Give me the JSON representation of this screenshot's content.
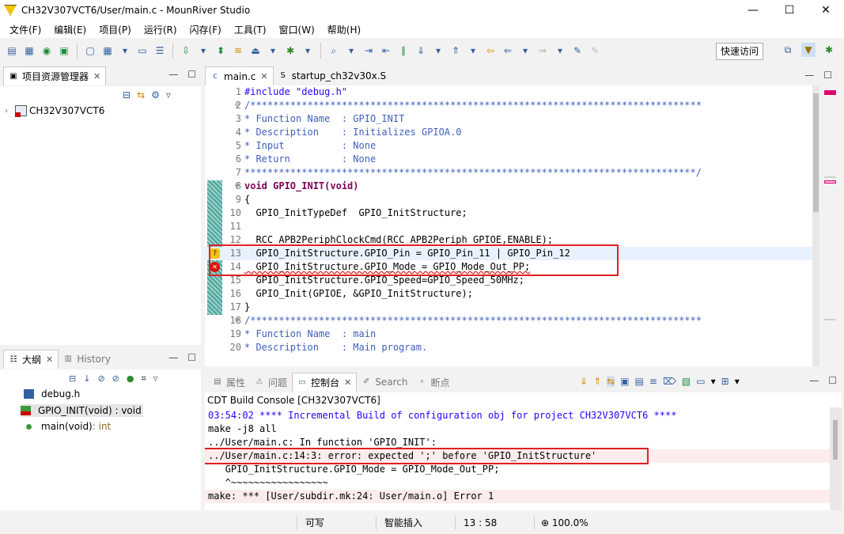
{
  "window": {
    "title": "CH32V307VCT6/User/main.c - MounRiver Studio",
    "minimize": "—",
    "maximize": "☐",
    "close": "✕"
  },
  "menu": [
    "文件(F)",
    "编辑(E)",
    "项目(P)",
    "运行(R)",
    "闪存(F)",
    "工具(T)",
    "窗口(W)",
    "帮助(H)"
  ],
  "toolbar": {
    "quick_access": "快速访问"
  },
  "explorer": {
    "tab_label": "项目资源管理器",
    "project_name": "CH32V307VCT6"
  },
  "outline": {
    "tab_label": "大纲",
    "history_label": "History",
    "items": [
      {
        "label": "debug.h",
        "suffix": ""
      },
      {
        "label": "GPIO_INIT(void) : void",
        "suffix": ""
      },
      {
        "label": "main(void)",
        "suffix": " : int"
      }
    ]
  },
  "editor": {
    "tabs": [
      "main.c",
      "startup_ch32v30x.S"
    ],
    "lines": [
      {
        "n": "1",
        "text": "#include \"debug.h\""
      },
      {
        "n": "2",
        "text": "/*******************************************************************************"
      },
      {
        "n": "3",
        "text": "* Function Name  : GPIO_INIT"
      },
      {
        "n": "4",
        "text": "* Description    : Initializes GPIOA.0"
      },
      {
        "n": "5",
        "text": "* Input          : None"
      },
      {
        "n": "6",
        "text": "* Return         : None"
      },
      {
        "n": "7",
        "text": "*******************************************************************************/"
      },
      {
        "n": "8",
        "text": "void GPIO_INIT(void)"
      },
      {
        "n": "9",
        "text": "{"
      },
      {
        "n": "10",
        "text": "  GPIO_InitTypeDef  GPIO_InitStructure;"
      },
      {
        "n": "11",
        "text": ""
      },
      {
        "n": "12",
        "text": "  RCC_APB2PeriphClockCmd(RCC_APB2Periph_GPIOE,ENABLE);"
      },
      {
        "n": "13",
        "text": "  GPIO_InitStructure.GPIO_Pin = GPIO_Pin_11 | GPIO_Pin_12"
      },
      {
        "n": "14",
        "text": "  GPIO_InitStructure.GPIO_Mode = GPIO_Mode_Out_PP;"
      },
      {
        "n": "15",
        "text": "  GPIO_InitStructure.GPIO_Speed=GPIO_Speed_50MHz;"
      },
      {
        "n": "16",
        "text": "  GPIO_Init(GPIOE, &GPIO_InitStructure);"
      },
      {
        "n": "17",
        "text": "}"
      },
      {
        "n": "18",
        "text": "/*******************************************************************************"
      },
      {
        "n": "19",
        "text": "* Function Name  : main"
      },
      {
        "n": "20",
        "text": "* Description    : Main program."
      }
    ]
  },
  "bottom": {
    "tabs": [
      "属性",
      "问题",
      "控制台",
      "Search",
      "断点"
    ],
    "console_title": "CDT Build Console [CH32V307VCT6]",
    "lines": [
      "03:54:02 **** Incremental Build of configuration obj for project CH32V307VCT6 ****",
      "make -j8 all",
      "../User/main.c: In function 'GPIO_INIT':",
      "../User/main.c:14:3: error: expected ';' before 'GPIO_InitStructure'",
      "   GPIO_InitStructure.GPIO_Mode = GPIO_Mode_Out_PP;",
      "   ^~~~~~~~~~~~~~~~~~",
      "make: *** [User/subdir.mk:24: User/main.o] Error 1"
    ]
  },
  "status": {
    "writable": "可写",
    "insert": "智能插入",
    "position": "13 : 58",
    "zoom": "100.0%"
  }
}
